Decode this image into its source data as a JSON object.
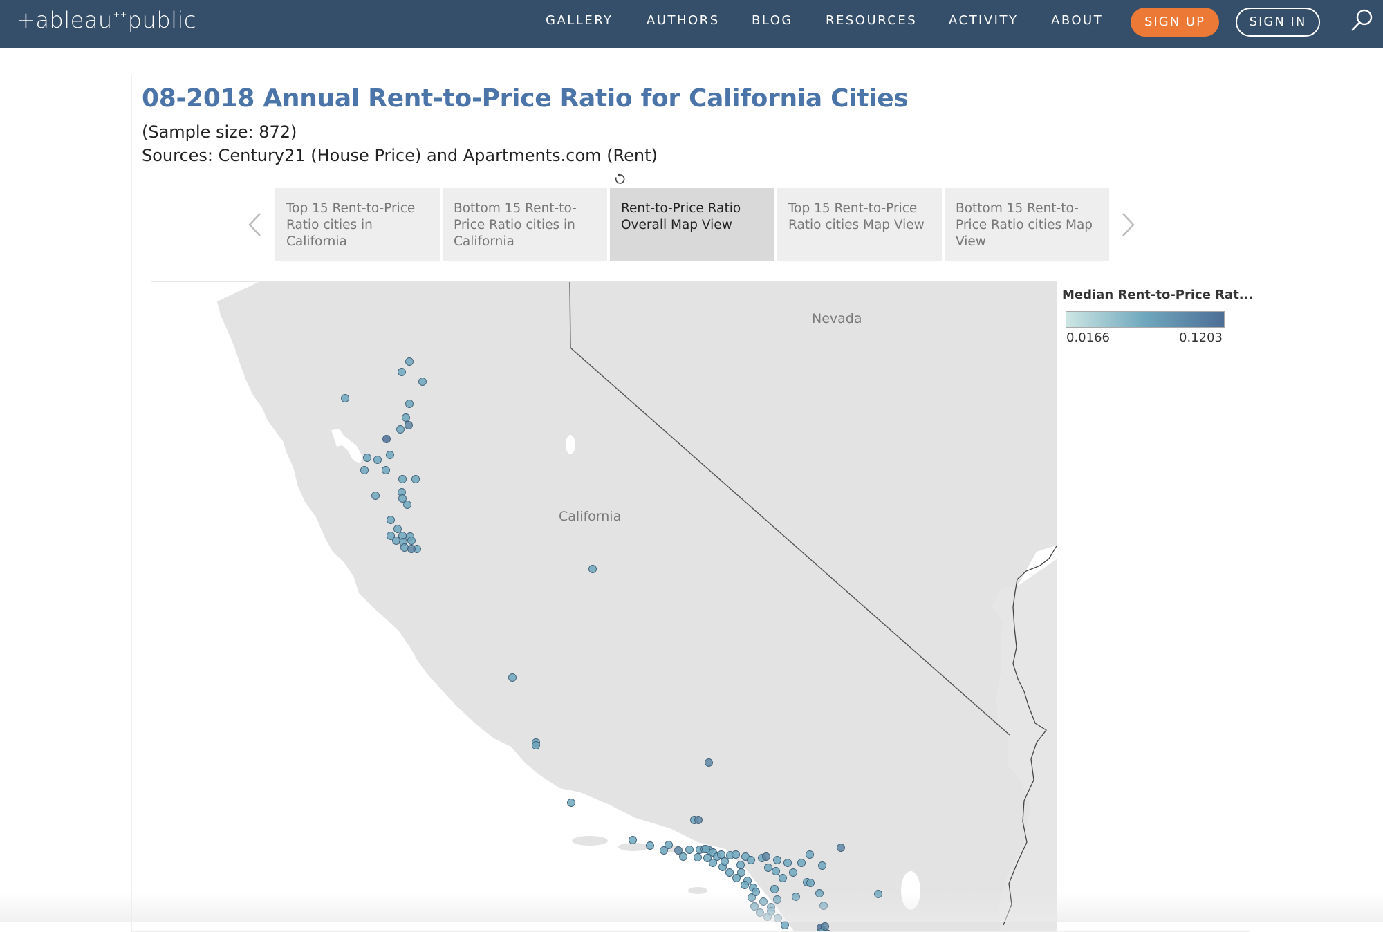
{
  "header": {
    "logo": {
      "pre": "+ableau",
      "post": "public",
      "spark": "⁺⁺"
    },
    "nav": [
      "GALLERY",
      "AUTHORS",
      "BLOG",
      "RESOURCES",
      "ACTIVITY",
      "ABOUT"
    ],
    "signup": "SIGN UP",
    "signin": "SIGN IN",
    "search_icon": "search-icon"
  },
  "viz": {
    "title": "08-2018 Annual Rent-to-Price Ratio for California Cities",
    "sample": "(Sample size: 872)",
    "sources": "Sources: Century21 (House Price) and Apartments.com (Rent)"
  },
  "tabs": [
    {
      "label": "Top 15 Rent-to-Price Ratio cities in California",
      "active": false
    },
    {
      "label": "Bottom 15 Rent-to-Price Ratio cities in California",
      "active": false
    },
    {
      "label": "Rent-to-Price Ratio Overall Map View",
      "active": true
    },
    {
      "label": "Top 15 Rent-to-Price Ratio cities Map View",
      "active": false
    },
    {
      "label": "Bottom 15 Rent-to-Price Ratio cities Map View",
      "active": false
    }
  ],
  "map": {
    "labels": {
      "nevada": "Nevada",
      "california": "California"
    }
  },
  "legend": {
    "title": "Median Rent-to-Price Rat...",
    "min": "0.0166",
    "max": "0.1203",
    "color_low": "#cde6e3",
    "color_mid": "#6fa7bd",
    "color_high": "#4d6e96"
  },
  "colors": {
    "nav_bg": "#354e6a",
    "signup_bg": "#ec7a36",
    "title": "#4b74a8",
    "land": "#e3e3e3"
  }
}
